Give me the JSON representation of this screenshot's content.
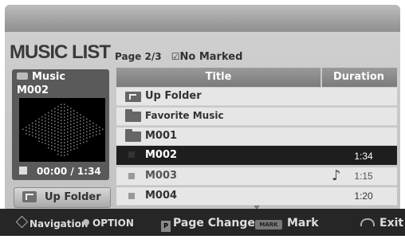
{
  "screen": {
    "title": "MUSIC LIST",
    "page_info": "Page 2/3",
    "marked_status": "No Marked",
    "check_glyph": "☑"
  },
  "preview": {
    "category_label": "Music",
    "current_track": "M002",
    "time_display": "00:00 / 1:34",
    "up_folder_label": "Up Folder"
  },
  "list": {
    "header_title": "Title",
    "header_duration": "Duration",
    "rows": [
      {
        "type": "up-folder",
        "name": "Up Folder",
        "duration": ""
      },
      {
        "type": "folder",
        "name": "Favorite Music",
        "duration": ""
      },
      {
        "type": "folder",
        "name": "M001",
        "duration": ""
      },
      {
        "type": "file",
        "name": "M002",
        "duration": "1:34",
        "selected": true
      },
      {
        "type": "file",
        "name": "M003",
        "duration": "1:15",
        "playing_icon": "music-note-icon"
      },
      {
        "type": "file",
        "name": "M004",
        "duration": "1:20"
      }
    ]
  },
  "bottom_bar": {
    "navigation": "Navigation",
    "option": "OPTION",
    "page_change": "Page Change",
    "mark_key": "MARK",
    "mark": "Mark",
    "exit": "Exit"
  },
  "colors": {
    "selected_row": "#1e1e1e",
    "header": "#8a8a8a",
    "bottom_bar": "#262626"
  }
}
